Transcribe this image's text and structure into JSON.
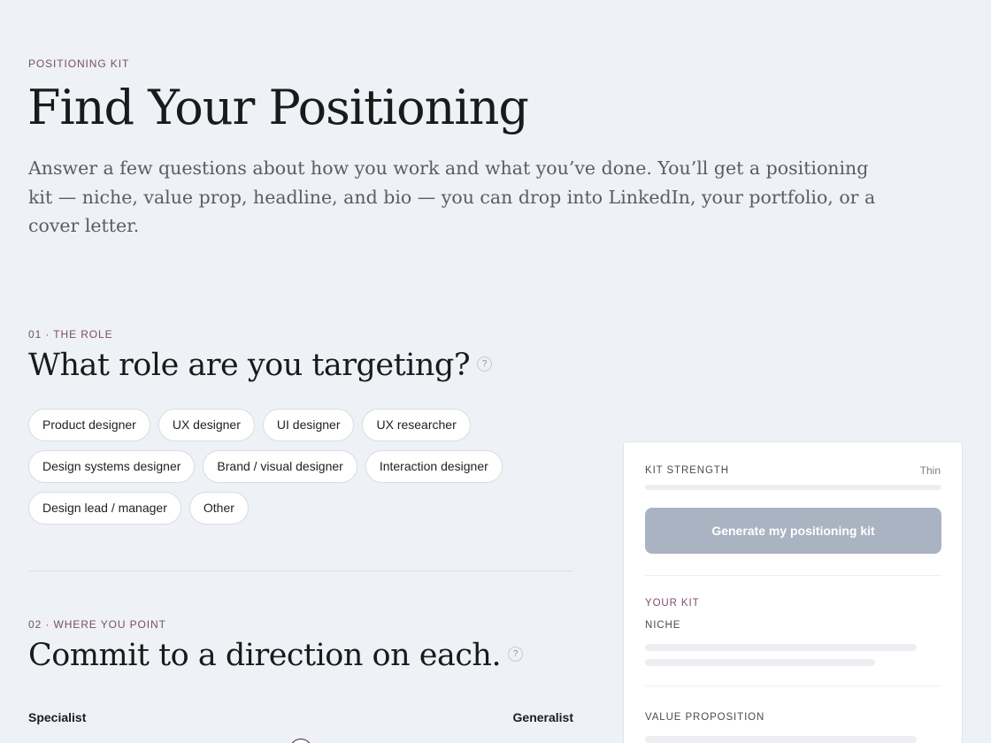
{
  "header": {
    "eyebrow": "POSITIONING KIT",
    "title": "Find Your Positioning",
    "subtitle": "Answer a few questions about how you work and what you’ve done. You’ll get a positioning kit — niche, value prop, headline, and bio — you can drop into LinkedIn, your portfolio, or a cover letter."
  },
  "section1": {
    "eyebrow": "01 · THE ROLE",
    "question": "What role are you targeting?",
    "help": "?",
    "roles": [
      "Product designer",
      "UX designer",
      "UI designer",
      "UX researcher",
      "Design systems designer",
      "Brand / visual designer",
      "Interaction designer",
      "Design lead / manager",
      "Other"
    ]
  },
  "section2": {
    "eyebrow": "02 · WHERE YOU POINT",
    "question": "Commit to a direction on each.",
    "help": "?",
    "slider": {
      "left_label": "Specialist",
      "right_label": "Generalist",
      "value": 0.5
    }
  },
  "panel": {
    "strength_label": "KIT STRENGTH",
    "strength_value": "Thin",
    "strength_fraction": 0,
    "generate_label": "Generate my positioning kit",
    "your_kit_label": "YOUR KIT",
    "niche_label": "NICHE",
    "value_prop_label": "VALUE PROPOSITION"
  },
  "colors": {
    "background": "#eef1f5",
    "accent": "#7a4d6e",
    "button_disabled": "#aab3c2"
  }
}
